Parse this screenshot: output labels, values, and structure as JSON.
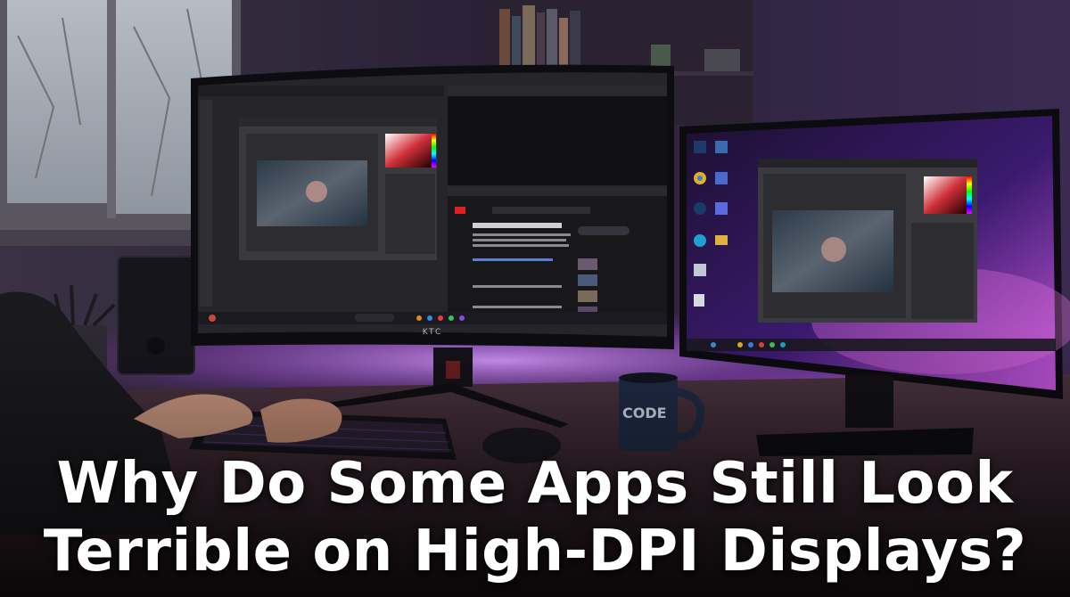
{
  "headline": {
    "line1": "Why Do Some Apps Still Look",
    "line2": "Terrible on High-DPI Displays?"
  },
  "monitor": {
    "brand": "KTC"
  },
  "mug": {
    "label": "CODE"
  },
  "colors": {
    "accent_purple": "#a24bd9",
    "backlight": "#c77dff",
    "headline_text": "#ffffff"
  },
  "icons": [
    "photoshop-app-icon",
    "chrome-icon",
    "steam-icon",
    "edge-icon",
    "folder-icon",
    "recycle-bin-icon"
  ]
}
